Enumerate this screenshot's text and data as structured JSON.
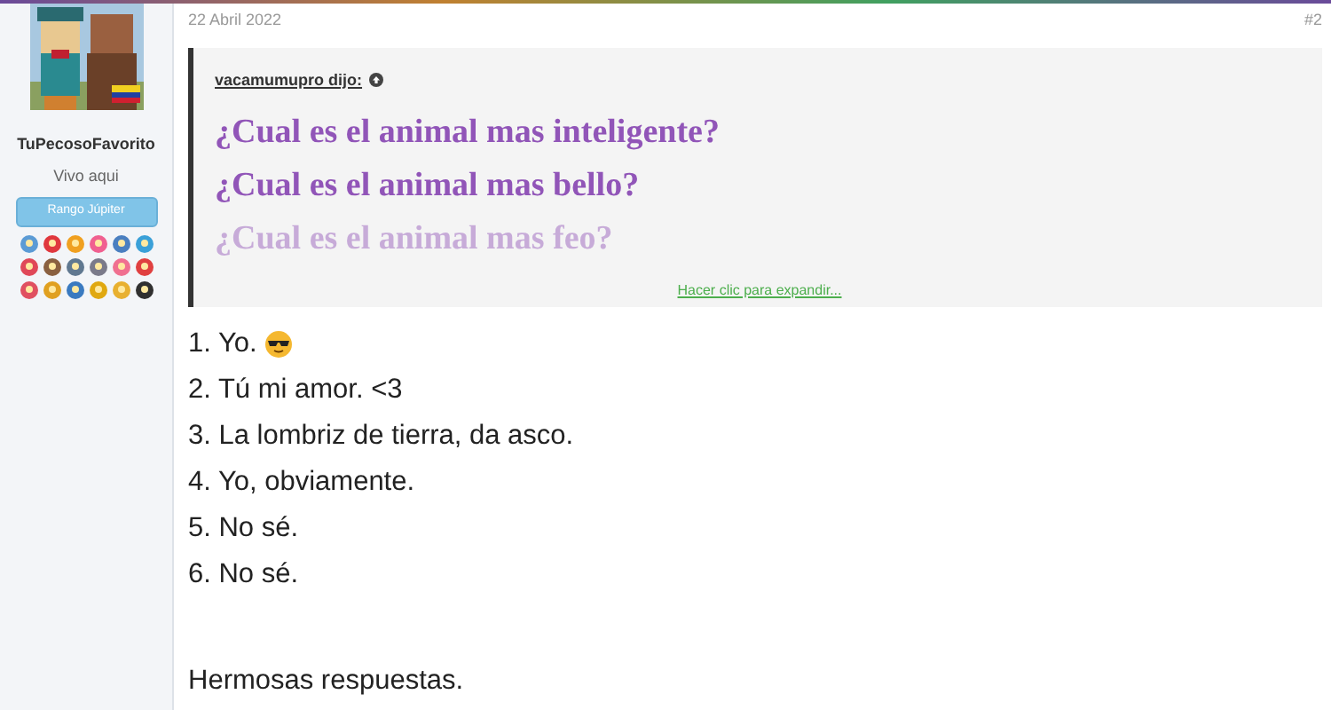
{
  "user": {
    "name": "TuPecosoFavorito",
    "title": "Vivo aqui",
    "rank": "Rango Júpiter",
    "badges": [
      {
        "color": "#5b9bd5"
      },
      {
        "color": "#e0383e"
      },
      {
        "color": "#f0a020"
      },
      {
        "color": "#f06090"
      },
      {
        "color": "#4a7fc0"
      },
      {
        "color": "#3aa0d8"
      },
      {
        "color": "#e04858"
      },
      {
        "color": "#8a6040"
      },
      {
        "color": "#607890"
      },
      {
        "color": "#7a7a8a"
      },
      {
        "color": "#f07090"
      },
      {
        "color": "#e04040"
      },
      {
        "color": "#e05060"
      },
      {
        "color": "#e0a020"
      },
      {
        "color": "#3a7ac0"
      },
      {
        "color": "#e0a810"
      },
      {
        "color": "#e8b030"
      },
      {
        "color": "#303030"
      }
    ]
  },
  "post": {
    "date": "22 Abril 2022",
    "number": "#2",
    "quote": {
      "author": "vacamumupro dijo:",
      "collapsed": true,
      "lines": [
        "¿Cual es el animal mas inteligente?",
        "¿Cual es el animal mas bello?",
        "¿Cual es el animal mas feo?"
      ],
      "expand": "Hacer clic para expandir..."
    },
    "lines": [
      {
        "text": "1. Yo.",
        "has_emoji": true
      },
      {
        "text": "2. Tú mi amor. <3",
        "has_emoji": false
      },
      {
        "text": "3. La lombriz de tierra, da asco.",
        "has_emoji": false
      },
      {
        "text": "4. Yo, obviamente.",
        "has_emoji": false
      },
      {
        "text": "5. No sé.",
        "has_emoji": false
      },
      {
        "text": "6. No sé.",
        "has_emoji": false
      }
    ],
    "closing": "Hermosas respuestas."
  }
}
